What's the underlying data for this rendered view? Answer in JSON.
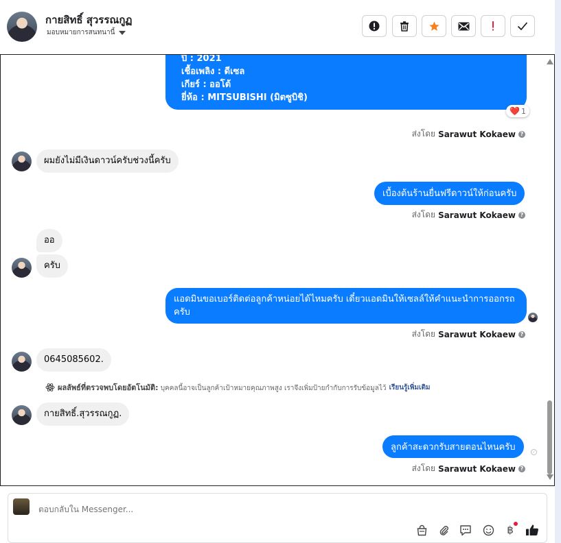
{
  "header": {
    "contact_name": "กายสิทธิ์ สุวรรณกูฏ",
    "assign_label": "มอบหมายการสนทนานี้",
    "actions": [
      "spam",
      "delete",
      "star",
      "mark-unread",
      "follow-up",
      "mark-done"
    ]
  },
  "messages": {
    "car_info": {
      "lines": [
        "ปี : 2021",
        "เชื้อเพลิง : ดีเซล",
        "เกียร์ : ออโต้",
        "ยี่ห้อ : MITSUBISHI (มิตซูบิชิ)"
      ],
      "reaction_emoji": "❤️",
      "reaction_count": "1"
    },
    "in_1": "ผมยังไม่มีเงินดาวน์ครับช่วงนี้ครับ",
    "out_1": "เบื้องต้นร้านยื่นฟรีดาวน์ให้ก่อนครับ",
    "in_2a": "ออ",
    "in_2b": "ครับ",
    "out_2": "แอดมินขอเบอร์ติดต่อลูกค้าหน่อยได้ไหมครับ เดี๋ยวแอดมินให้เซลล์ให้คำแนะนำการออกรถครับ",
    "in_3": "0645085602.",
    "ai_notice": {
      "title": "ผลลัพธ์ที่ตรวจพบโดยอัตโนมัติ:",
      "body": " บุคคลนี้อาจเป็นลูกค้าเป้าหมายคุณภาพสูง เราจึงเพิ่มป้ายกำกับการรับข้อมูลไว้",
      "link": "เรียนรู้เพิ่มเติม"
    },
    "in_4": "กายสิทธิ์.สุวรรณกูฏ.",
    "out_3": "ลูกค้าสะดวกรับสายตอนไหนครับ"
  },
  "sent_by": {
    "prefix": "ส่งโดย",
    "name": "Sarawut Kokaew"
  },
  "reply_box": {
    "placeholder": "ตอบกลับใน Messenger..."
  },
  "colors": {
    "outgoing_bubble": "#0a7cff",
    "incoming_bubble": "#f0f0f0",
    "star": "#f5821f",
    "follow_up": "#e41e3f",
    "link": "#385898"
  }
}
